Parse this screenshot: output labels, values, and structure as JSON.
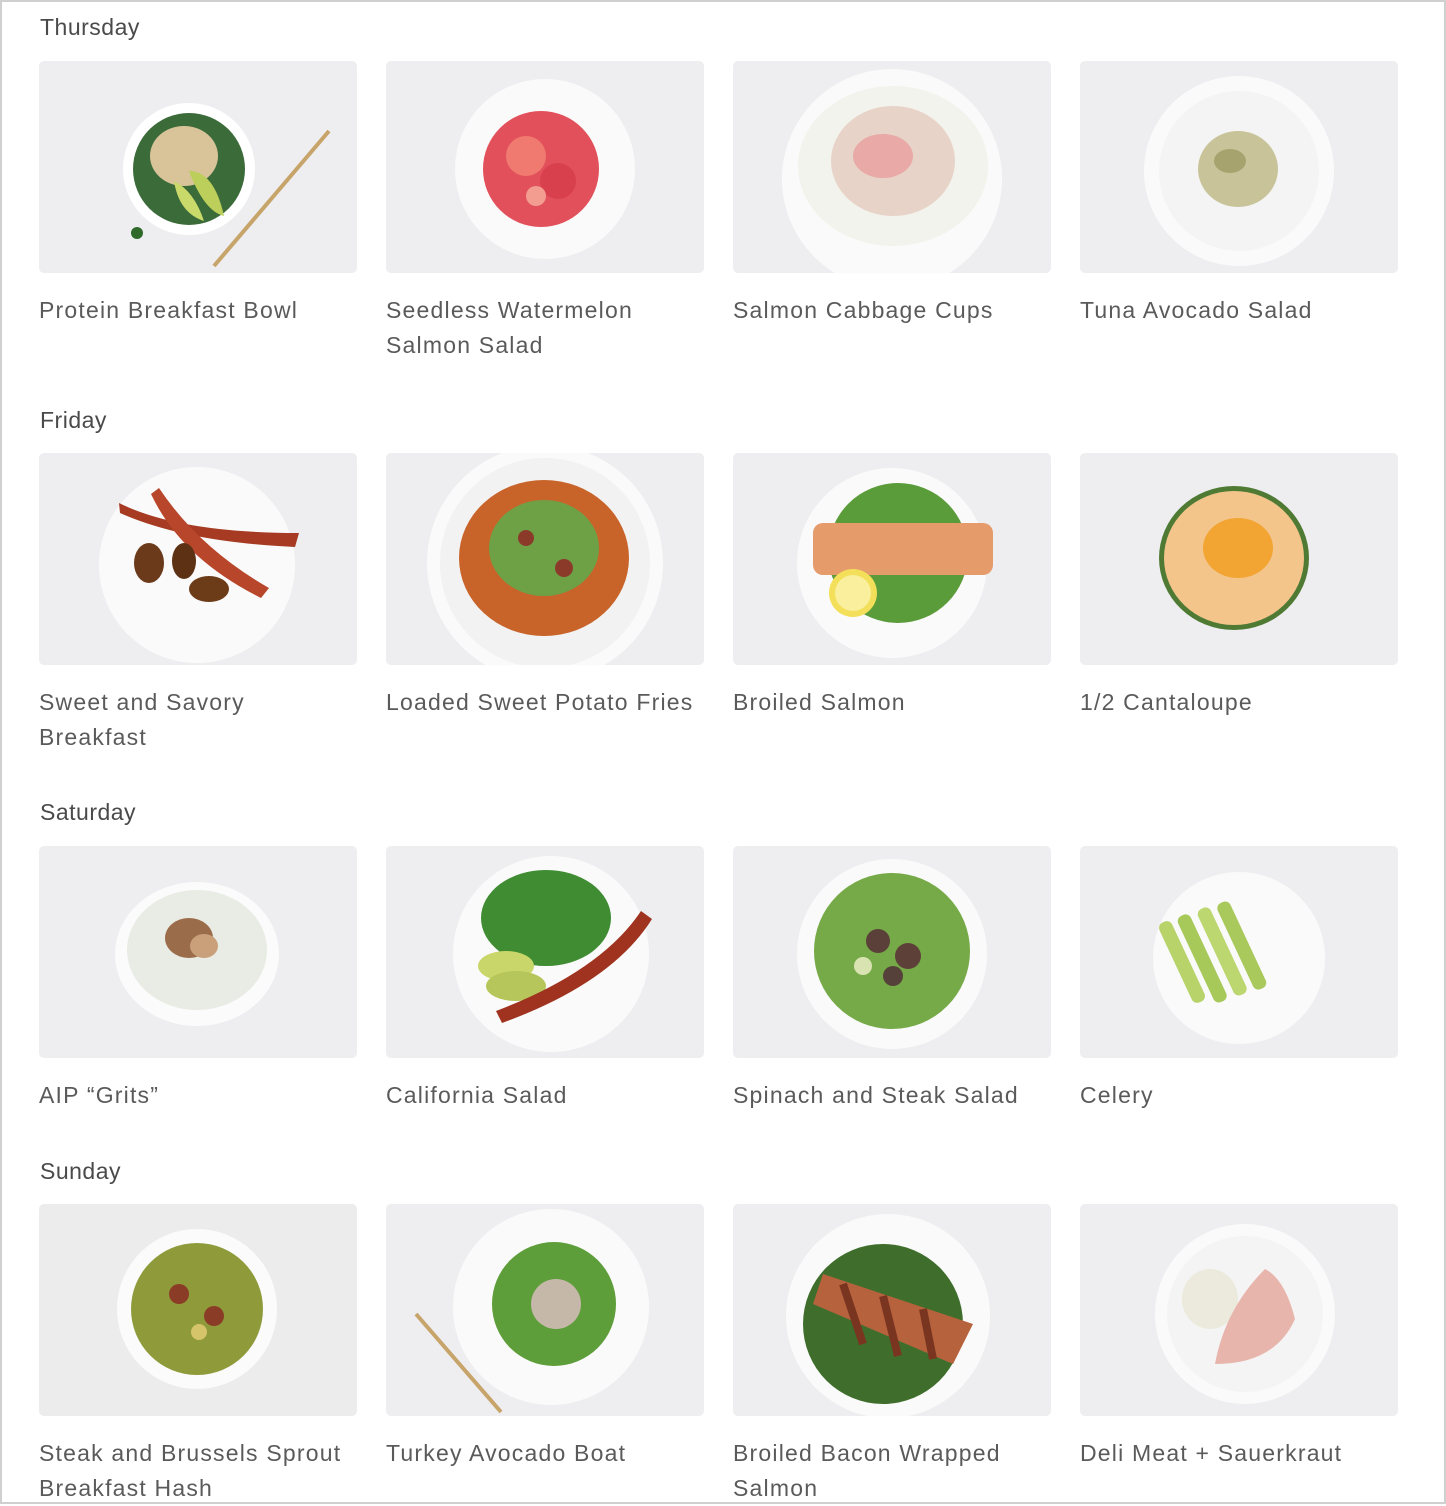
{
  "days": [
    {
      "label": "Thursday",
      "meals": [
        {
          "title": "Protein Breakfast Bowl",
          "icon": "bowl-icon"
        },
        {
          "title": "Seedless Watermelon Salmon Salad",
          "icon": "plate-icon"
        },
        {
          "title": "Salmon Cabbage Cups",
          "icon": "plate-icon"
        },
        {
          "title": "Tuna Avocado Salad",
          "icon": "plate-icon"
        }
      ]
    },
    {
      "label": "Friday",
      "meals": [
        {
          "title": "Sweet and Savory Breakfast",
          "icon": "plate-icon"
        },
        {
          "title": "Loaded Sweet Potato Fries",
          "icon": "plate-icon"
        },
        {
          "title": "Broiled Salmon",
          "icon": "plate-icon"
        },
        {
          "title": "1/2 Cantaloupe",
          "icon": "melon-icon"
        }
      ]
    },
    {
      "label": "Saturday",
      "meals": [
        {
          "title": "AIP “Grits”",
          "icon": "bowl-icon"
        },
        {
          "title": "California Salad",
          "icon": "plate-icon"
        },
        {
          "title": "Spinach and Steak Salad",
          "icon": "plate-icon"
        },
        {
          "title": "Celery",
          "icon": "plate-icon"
        }
      ]
    },
    {
      "label": "Sunday",
      "meals": [
        {
          "title": "Steak and Brussels Sprout Breakfast Hash",
          "icon": "bowl-icon"
        },
        {
          "title": "Turkey Avocado Boat",
          "icon": "plate-icon"
        },
        {
          "title": "Broiled Bacon Wrapped Salmon",
          "icon": "plate-icon"
        },
        {
          "title": "Deli Meat + Sauerkraut",
          "icon": "plate-icon"
        }
      ]
    }
  ],
  "colors": {
    "background": "#ffffff",
    "thumb_bg": "#eeeef1",
    "plate": "#fafafa",
    "text": "#5a5a5a"
  }
}
